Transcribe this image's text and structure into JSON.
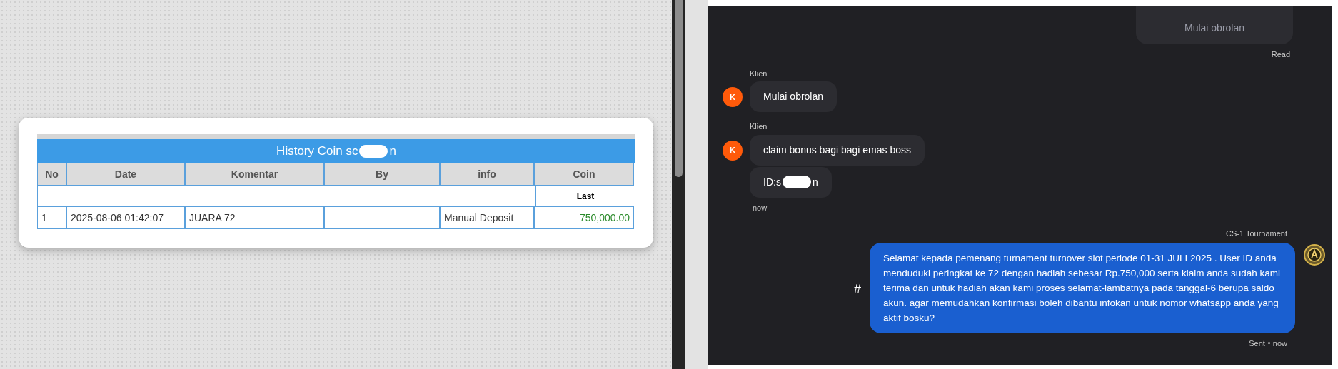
{
  "history_table": {
    "title_start": "History Coin sc",
    "title_end": "n",
    "columns": [
      "No",
      "Date",
      "Komentar",
      "By",
      "info",
      "Coin"
    ],
    "subheader": "Last",
    "rows": [
      {
        "no": "1",
        "date": "2025-08-06 01:42:07",
        "komentar": "JUARA 72",
        "by": "",
        "info": "Manual Deposit",
        "coin": "750,000.00"
      }
    ]
  },
  "chat": {
    "messages": [
      {
        "kind": "outgoing_cut",
        "text": "Mulai obrolan",
        "status": "Read"
      },
      {
        "kind": "incoming",
        "sender": "Klien",
        "avatar": "K",
        "bubbles": [
          {
            "text": "Mulai obrolan"
          }
        ]
      },
      {
        "kind": "incoming",
        "sender": "Klien",
        "avatar": "K",
        "bubbles": [
          {
            "text": "claim bonus bagi bagi emas boss"
          },
          {
            "text": "ID:s",
            "text_end": "n"
          }
        ],
        "time": "now"
      },
      {
        "kind": "outgoing",
        "sender": "CS-1 Tournament",
        "marker": "#",
        "text": "Selamat kepada pemenang turnament turnover slot periode 01-31 JULI 2025 . User ID anda menduduki peringkat ke 72 dengan hadiah sebesar Rp.750,000 serta klaim anda sudah kami terima dan untuk hadiah akan kami proses selamat-lambatnya pada tanggal-6 berupa saldo akun. agar memudahkan konfirmasi boleh dibantu infokan untuk nomor whatsapp anda yang aktif bosku?",
        "status": "Sent",
        "time": "now"
      }
    ]
  }
}
